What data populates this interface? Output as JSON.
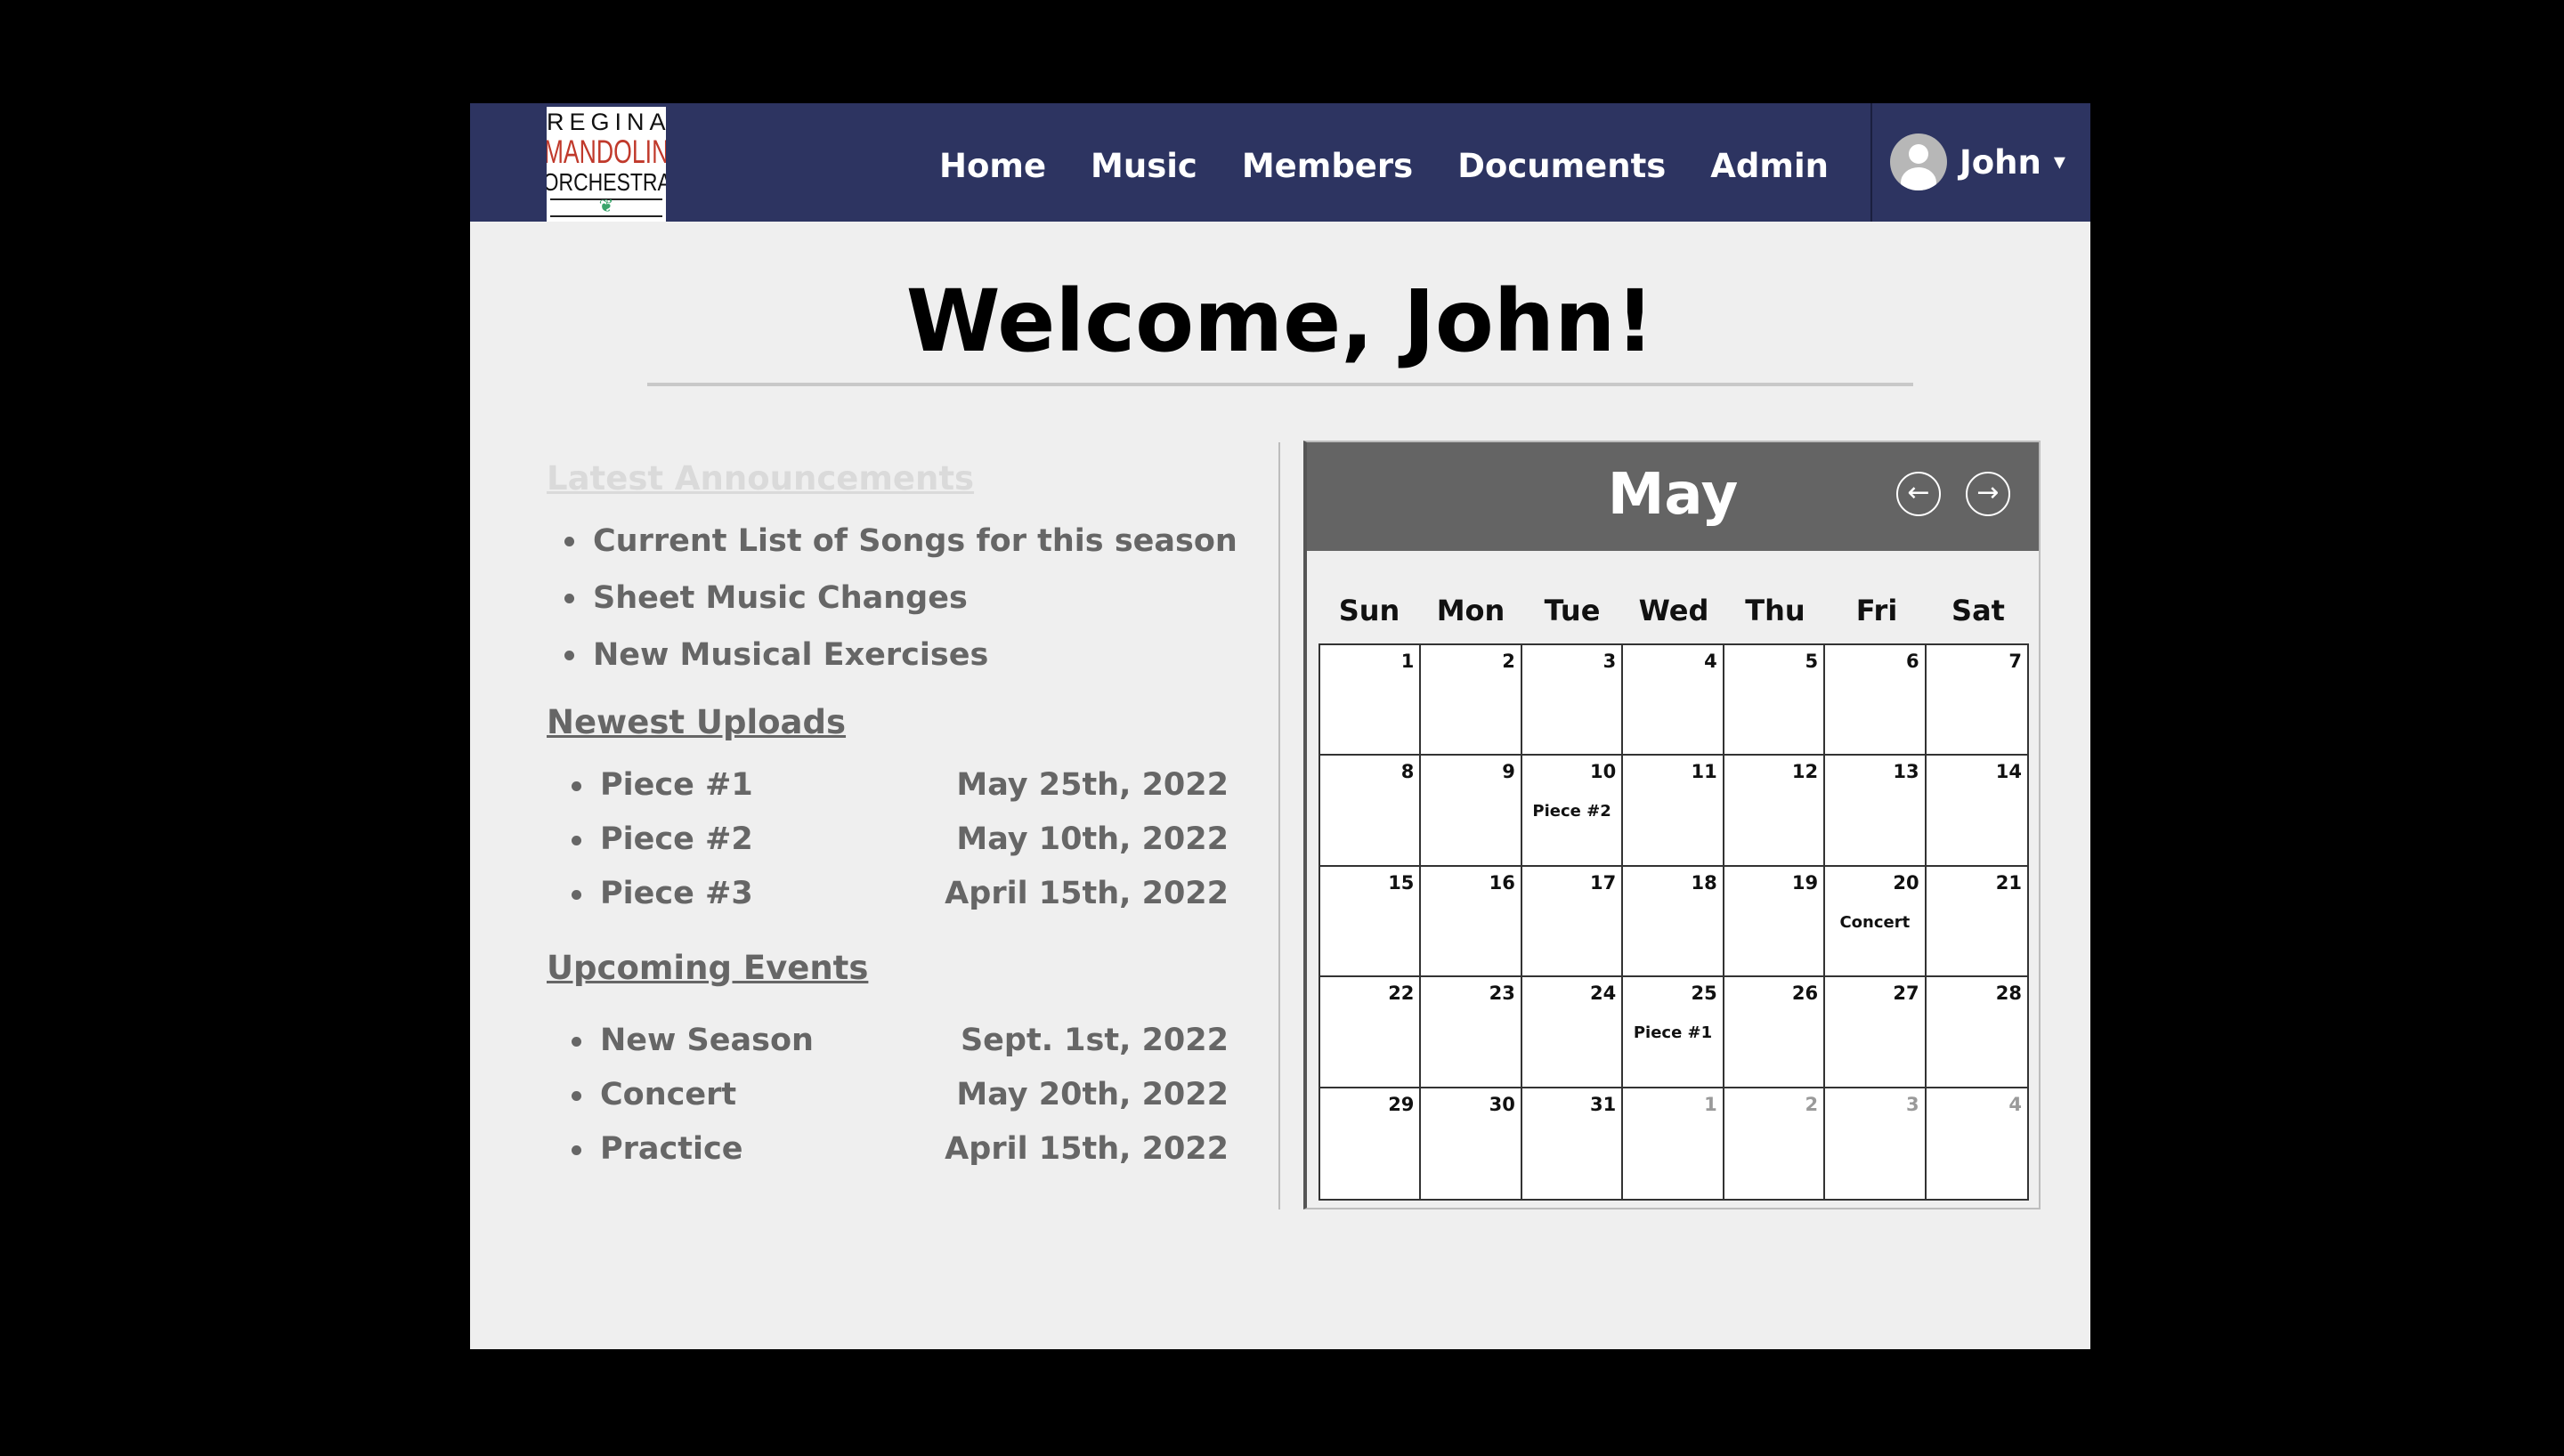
{
  "header": {
    "logo": {
      "line1": "REGINA",
      "line2": "MANDOLIN",
      "line3": "ORCHESTRA"
    },
    "nav": [
      "Home",
      "Music",
      "Members",
      "Documents",
      "Admin"
    ],
    "user": {
      "name": "John",
      "caret": "▾"
    }
  },
  "welcome": "Welcome, John!",
  "announcements": {
    "title": "Latest Announcements",
    "items": [
      "Current List of Songs for this season",
      "Sheet Music Changes",
      "New Musical Exercises"
    ]
  },
  "uploads": {
    "title": "Newest Uploads",
    "items": [
      {
        "name": "Piece #1",
        "date": "May 25th, 2022"
      },
      {
        "name": "Piece #2",
        "date": "May 10th, 2022"
      },
      {
        "name": "Piece #3",
        "date": "April 15th, 2022"
      }
    ]
  },
  "events": {
    "title": "Upcoming Events",
    "items": [
      {
        "name": "New Season",
        "date": "Sept. 1st, 2022"
      },
      {
        "name": "Concert",
        "date": "May 20th, 2022"
      },
      {
        "name": "Practice",
        "date": "April 15th, 2022"
      }
    ]
  },
  "calendar": {
    "month": "May",
    "prev": "←",
    "next": "→",
    "days": [
      "Sun",
      "Mon",
      "Tue",
      "Wed",
      "Thu",
      "Fri",
      "Sat"
    ],
    "cells": [
      {
        "d": "1"
      },
      {
        "d": "2"
      },
      {
        "d": "3"
      },
      {
        "d": "4"
      },
      {
        "d": "5"
      },
      {
        "d": "6"
      },
      {
        "d": "7"
      },
      {
        "d": "8"
      },
      {
        "d": "9"
      },
      {
        "d": "10",
        "event": "Piece #2"
      },
      {
        "d": "11"
      },
      {
        "d": "12"
      },
      {
        "d": "13"
      },
      {
        "d": "14"
      },
      {
        "d": "15"
      },
      {
        "d": "16"
      },
      {
        "d": "17"
      },
      {
        "d": "18"
      },
      {
        "d": "19"
      },
      {
        "d": "20",
        "event": "Concert"
      },
      {
        "d": "21"
      },
      {
        "d": "22"
      },
      {
        "d": "23"
      },
      {
        "d": "24"
      },
      {
        "d": "25",
        "event": "Piece #1"
      },
      {
        "d": "26"
      },
      {
        "d": "27"
      },
      {
        "d": "28"
      },
      {
        "d": "29"
      },
      {
        "d": "30"
      },
      {
        "d": "31"
      },
      {
        "d": "1",
        "other": true
      },
      {
        "d": "2",
        "other": true
      },
      {
        "d": "3",
        "other": true
      },
      {
        "d": "4",
        "other": true
      }
    ]
  }
}
